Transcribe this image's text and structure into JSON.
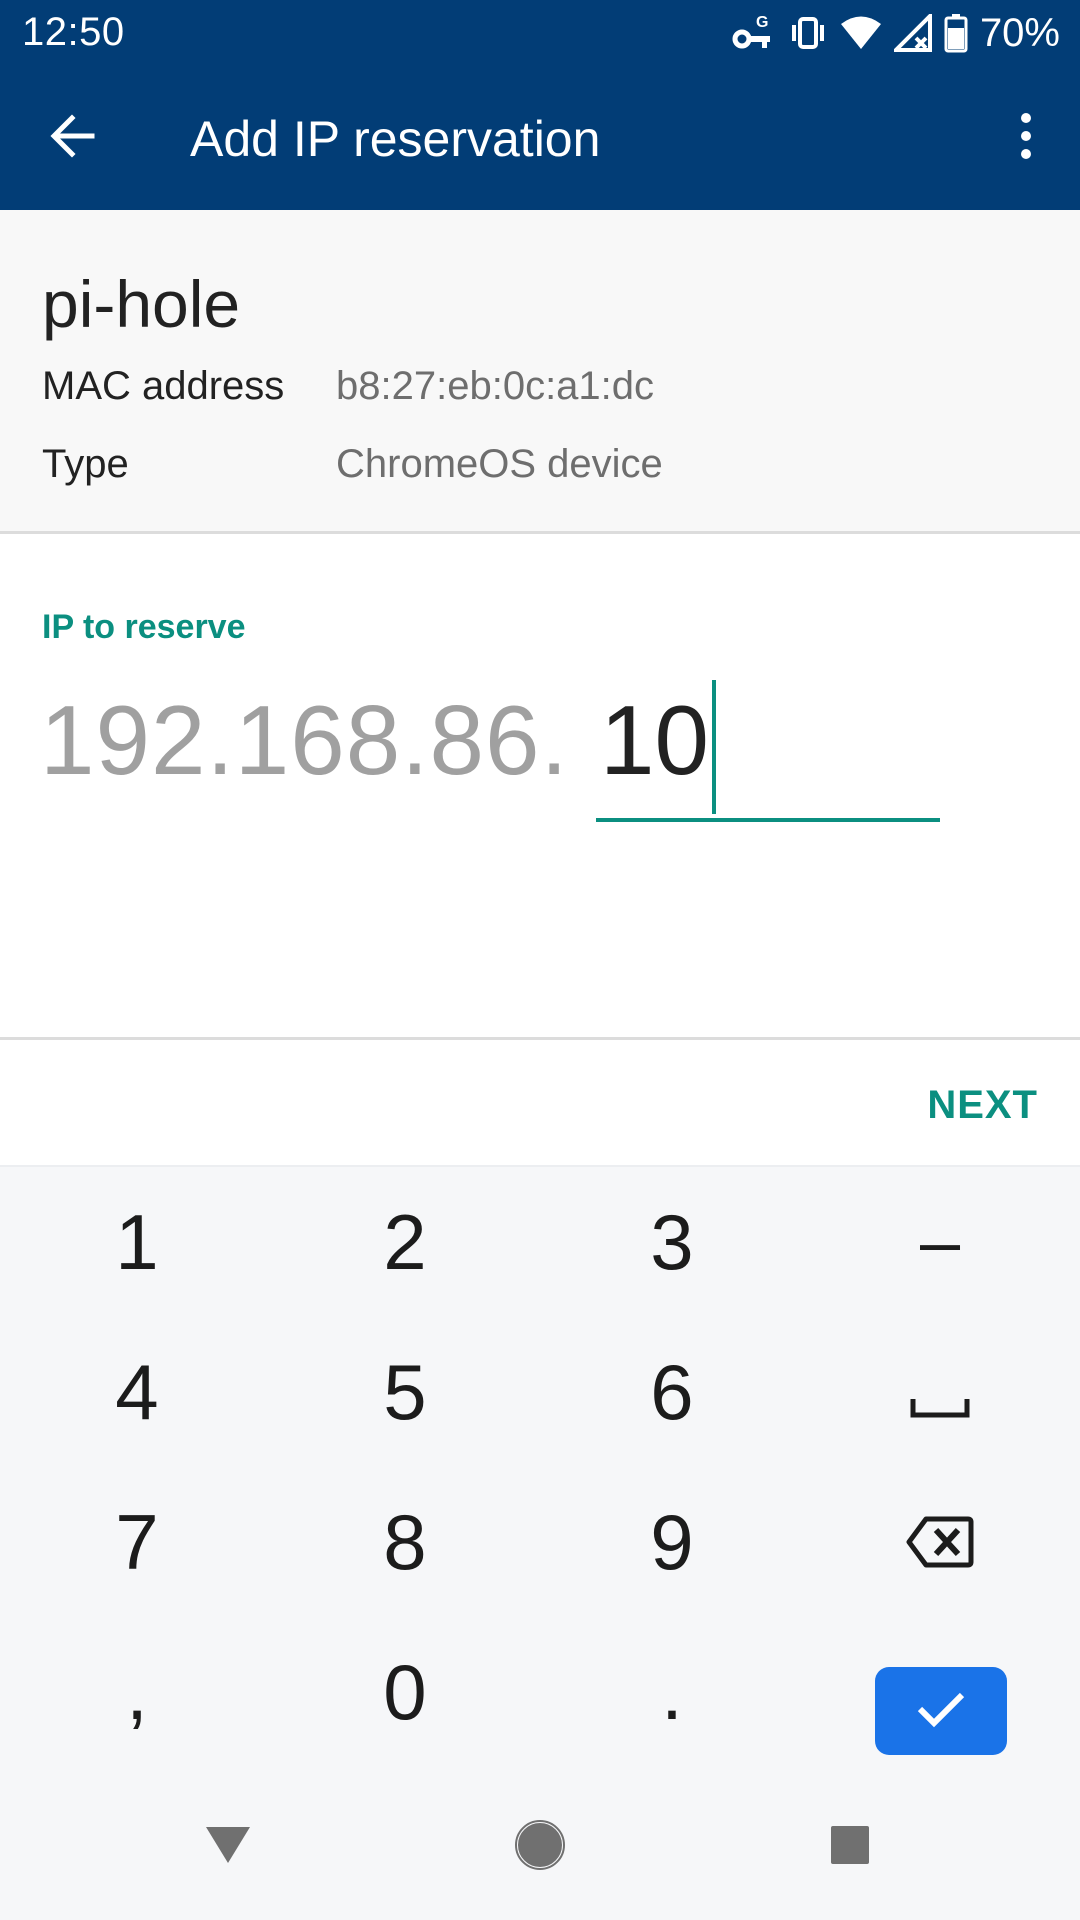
{
  "status_bar": {
    "time": "12:50",
    "battery_percent": "70%",
    "icons": [
      "vpn-key-icon",
      "vibrate-icon",
      "wifi-icon",
      "no-signal-icon",
      "battery-icon"
    ]
  },
  "app_bar": {
    "title": "Add IP reservation",
    "back_icon": "arrow-left-icon",
    "menu_icon": "more-vert-icon"
  },
  "device": {
    "name": "pi-hole",
    "mac_label": "MAC address",
    "mac_value": "b8:27:eb:0c:a1:dc",
    "type_label": "Type",
    "type_value": "ChromeOS device"
  },
  "ip_field": {
    "label": "IP to reserve",
    "prefix": "192.168.86.",
    "value": "10"
  },
  "actions": {
    "next_label": "NEXT"
  },
  "keypad": {
    "keys": [
      "1",
      "2",
      "3",
      "–",
      "4",
      "5",
      "6",
      "space",
      "7",
      "8",
      "9",
      "backspace",
      ",",
      "0",
      ".",
      "done"
    ],
    "k1": "1",
    "k2": "2",
    "k3": "3",
    "k_dash": "–",
    "k4": "4",
    "k5": "5",
    "k6": "6",
    "k7": "7",
    "k8": "8",
    "k9": "9",
    "k_comma": ",",
    "k0": "0",
    "k_dot": "."
  },
  "colors": {
    "app_bar_bg": "#023d76",
    "accent_teal": "#0b8f80",
    "done_key_blue": "#1a73e8"
  }
}
